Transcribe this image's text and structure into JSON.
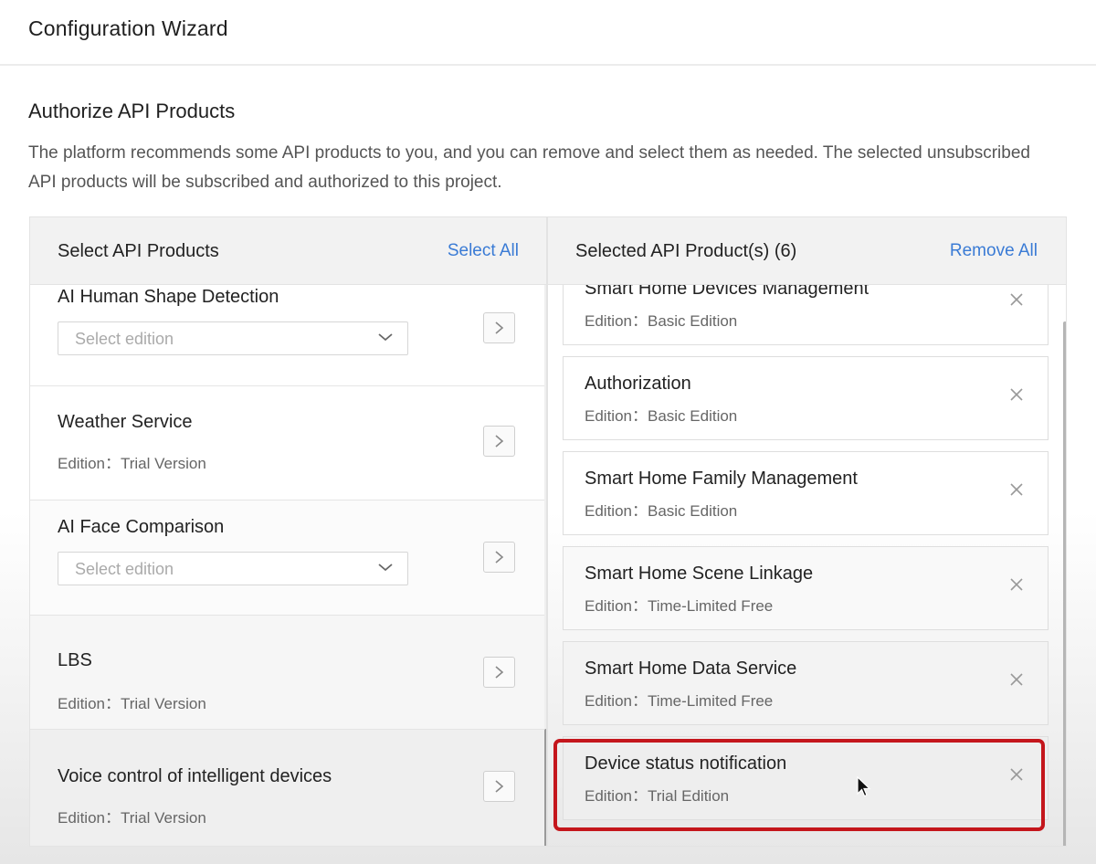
{
  "header": {
    "title": "Configuration Wizard"
  },
  "section": {
    "title": "Authorize API Products",
    "description": "The platform recommends some API products to you, and you can remove and select them as needed. The selected unsubscribed API products will be subscribed and authorized to this project."
  },
  "left_panel": {
    "title": "Select API Products",
    "action": "Select All",
    "items": [
      {
        "name": "AI Human Shape Detection",
        "select_placeholder": "Select edition"
      },
      {
        "name": "Weather Service",
        "edition": "Edition：Trial Version"
      },
      {
        "name": "AI Face Comparison",
        "select_placeholder": "Select edition"
      },
      {
        "name": "LBS",
        "edition": "Edition：Trial Version"
      },
      {
        "name": "Voice control of intelligent devices",
        "edition": "Edition：Trial Version"
      }
    ]
  },
  "right_panel": {
    "title": "Selected API Product(s) (6)",
    "action": "Remove All",
    "items": [
      {
        "name": "Smart Home Devices Management",
        "edition": "Edition：Basic Edition"
      },
      {
        "name": "Authorization",
        "edition": "Edition：Basic Edition"
      },
      {
        "name": "Smart Home Family Management",
        "edition": "Edition：Basic Edition"
      },
      {
        "name": "Smart Home Scene Linkage",
        "edition": "Edition：Time-Limited Free"
      },
      {
        "name": "Smart Home Data Service",
        "edition": "Edition：Time-Limited Free"
      },
      {
        "name": "Device status notification",
        "edition": "Edition：Trial Edition"
      }
    ]
  },
  "colors": {
    "link": "#3a7bd5",
    "highlight": "#c4161c"
  },
  "icons": [
    "chevron-down-icon",
    "chevron-right-icon",
    "close-icon",
    "mouse-cursor-icon"
  ]
}
